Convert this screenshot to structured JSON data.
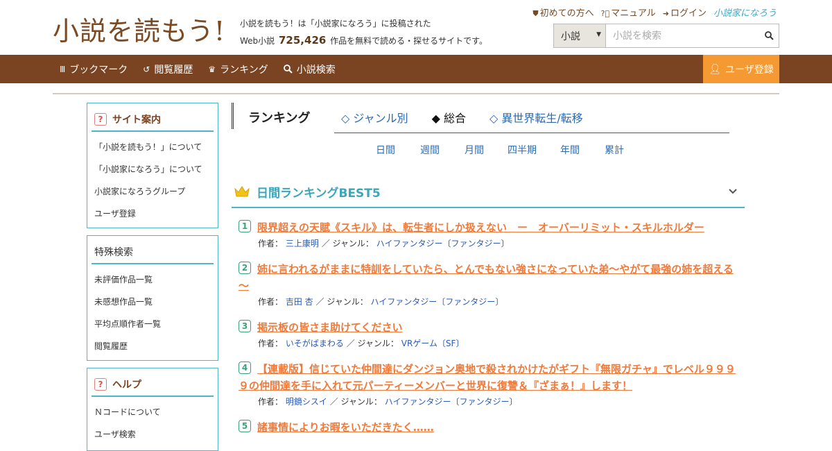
{
  "header": {
    "logo_text": "小説を読もう!",
    "tagline_line1": "小説を読もう！は「小説家になろう」に投稿された",
    "tagline_prefix": "Web小説",
    "work_count": "725,426",
    "tagline_suffix": "作品を無料で読める・探せるサイトです。",
    "links": {
      "first_time": "初めての方へ",
      "manual": "マニュアル",
      "login": "ログイン",
      "narou": "小説家になろう"
    },
    "search": {
      "select_value": "小説",
      "placeholder": "小説を検索"
    }
  },
  "nav": {
    "items": [
      "ブックマーク",
      "閲覧履歴",
      "ランキング",
      "小説検索"
    ],
    "register": "ユーザ登録"
  },
  "sidebar": {
    "site_guide": {
      "title": "サイト案内",
      "items": [
        "「小説を読もう！」について",
        "「小説家になろう」について",
        "小説家になろうグループ",
        "ユーザ登録"
      ]
    },
    "special_search": {
      "title": "特殊検索",
      "items": [
        "未評価作品一覧",
        "未感想作品一覧",
        "平均点順作者一覧",
        "閲覧履歴"
      ]
    },
    "help": {
      "title": "ヘルプ",
      "items": [
        "Ｎコードについて",
        "ユーザ検索"
      ]
    }
  },
  "ranking": {
    "title": "ランキング",
    "tabs": [
      "◇ ジャンル別",
      "◆ 総合",
      "◇ 異世界転生/転移"
    ],
    "periods": [
      "日間",
      "週間",
      "月間",
      "四半期",
      "年間",
      "累計"
    ],
    "best_title": "日間ランキングBEST5",
    "author_label": "作者：",
    "genre_label": "／ ジャンル：",
    "entries": [
      {
        "rank": "1",
        "title": "限界超えの天賦《スキル》は、転生者にしか扱えない　ー　オーバーリミット・スキルホルダー",
        "author": "三上康明",
        "genre": "ハイファンタジー〔ファンタジー〕"
      },
      {
        "rank": "2",
        "title": "姉に言われるがままに特訓をしていたら、とんでもない強さになっていた弟～やがて最強の姉を超える～",
        "author": "吉田 杏",
        "genre": "ハイファンタジー〔ファンタジー〕"
      },
      {
        "rank": "3",
        "title": "掲示板の皆さま助けてください",
        "author": "いそがばまわる",
        "genre": "VRゲーム〔SF〕"
      },
      {
        "rank": "4",
        "title": "【連載版】信じていた仲間達にダンジョン奥地で殺されかけたがギフト『無限ガチャ』でレベル９９９９の仲間達を手に入れて元パーティーメンバーと世界に復讐＆『ざまぁ！』します！",
        "author": "明鏡シスイ",
        "genre": "ハイファンタジー〔ファンタジー〕"
      },
      {
        "rank": "5",
        "title": "諸事情によりお暇をいただきたく……",
        "author": "",
        "genre": ""
      }
    ]
  }
}
